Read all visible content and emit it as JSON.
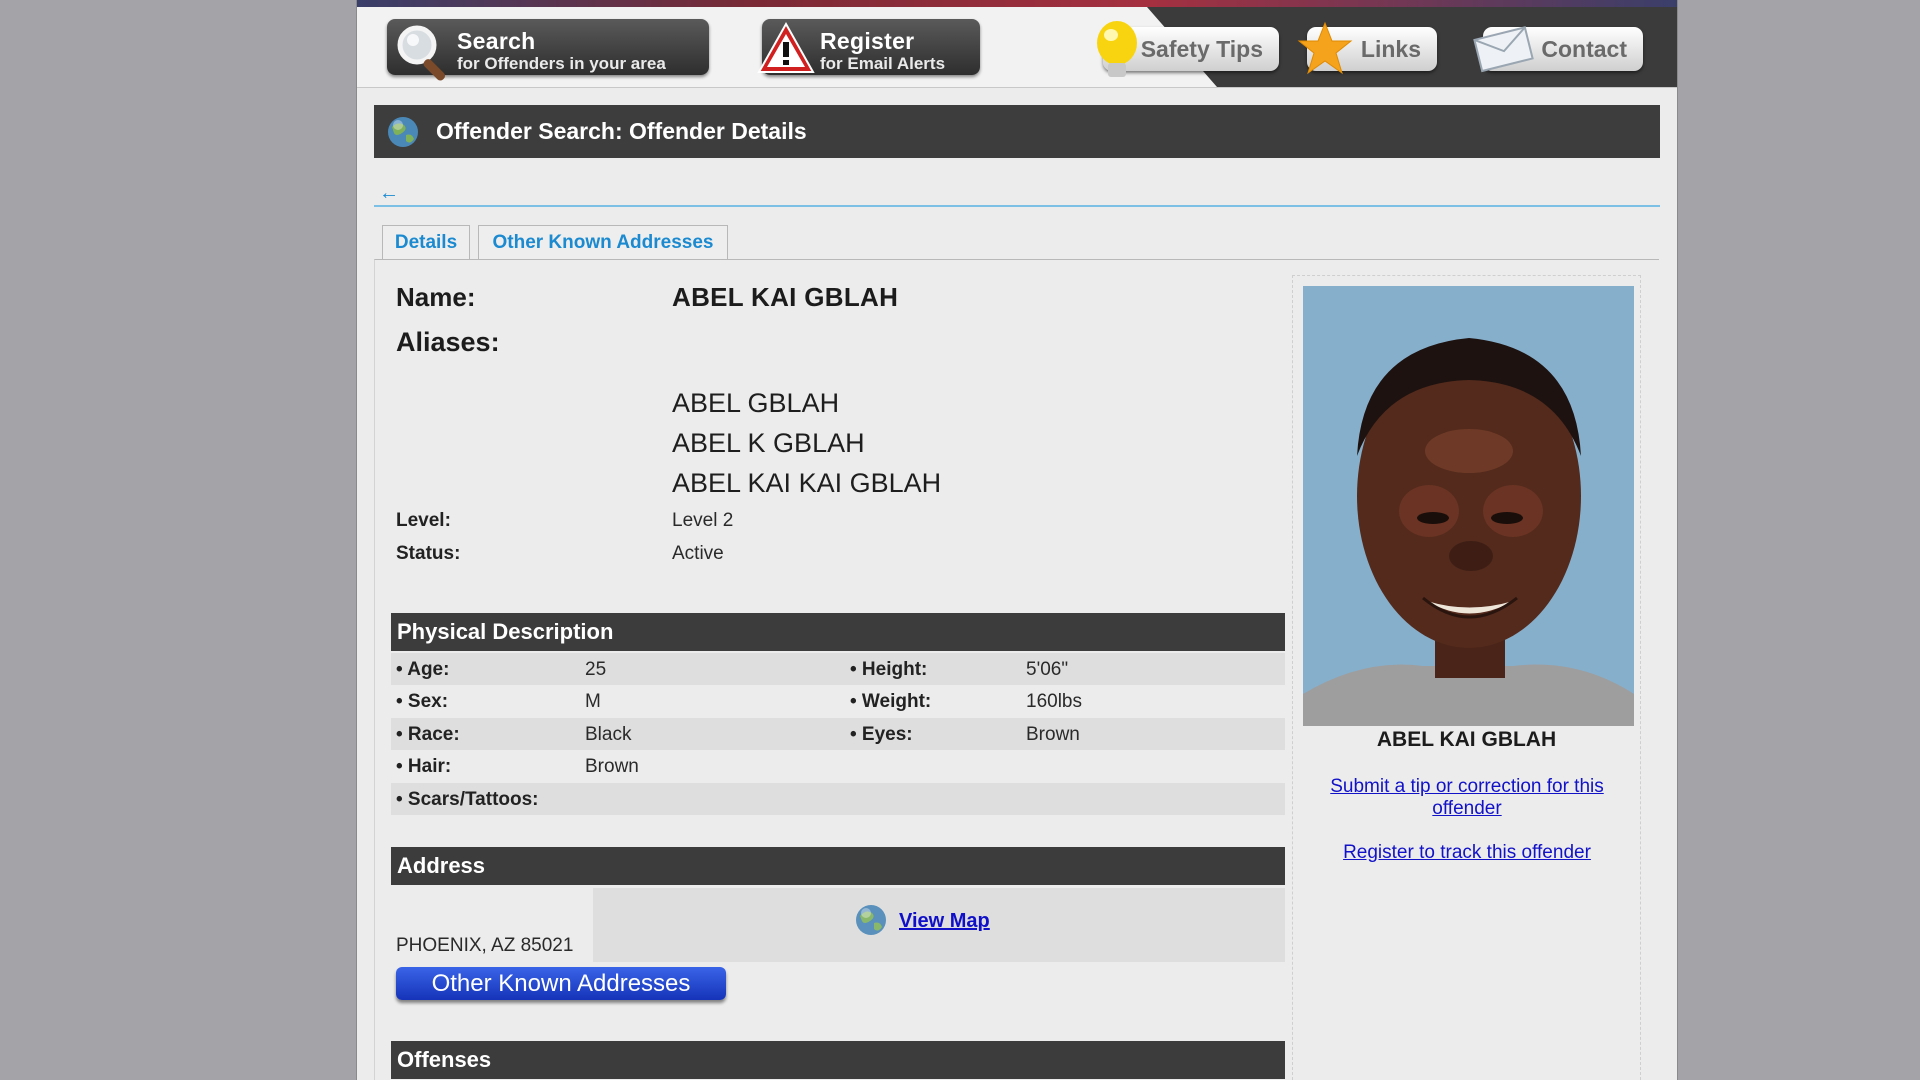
{
  "nav": {
    "search": {
      "title": "Search",
      "subtitle": "for Offenders in your area",
      "icon": "magnifier-icon"
    },
    "register": {
      "title": "Register",
      "subtitle": "for Email Alerts",
      "icon": "warning-icon"
    },
    "safety_tips": {
      "label": "Safety Tips",
      "icon": "lightbulb-icon"
    },
    "links": {
      "label": "Links",
      "icon": "star-icon"
    },
    "contact": {
      "label": "Contact",
      "icon": "envelope-icon"
    }
  },
  "page_title": "Offender Search: Offender Details",
  "back_arrow": "←",
  "tabs": [
    {
      "label": "Details",
      "active": true
    },
    {
      "label": "Other Known Addresses",
      "active": false
    }
  ],
  "details": {
    "name_label": "Name:",
    "name": "ABEL KAI GBLAH",
    "aliases_label": "Aliases:",
    "aliases": [
      "ABEL GBLAH",
      "ABEL K GBLAH",
      "ABEL KAI KAI GBLAH"
    ],
    "level_label": "Level:",
    "level": "Level 2",
    "status_label": "Status:",
    "status": "Active"
  },
  "physical": {
    "title": "Physical Description",
    "age_label": "• Age:",
    "age": "25",
    "height_label": "• Height:",
    "height": "5'06\"",
    "sex_label": "• Sex:",
    "sex": "M",
    "weight_label": "• Weight:",
    "weight": "160lbs",
    "race_label": "• Race:",
    "race": "Black",
    "eyes_label": "• Eyes:",
    "eyes": "Brown",
    "hair_label": "• Hair:",
    "hair": "Brown",
    "scars_label": "• Scars/Tattoos:",
    "scars": ""
  },
  "address": {
    "title": "Address",
    "text": "PHOENIX, AZ 85021",
    "view_map": "View Map",
    "other_button": "Other Known Addresses"
  },
  "offenses": {
    "title": "Offenses"
  },
  "sidebar": {
    "photo_name": "ABEL KAI GBLAH",
    "tip_link": "Submit a tip or correction for this offender",
    "track_link": "Register to track this offender"
  },
  "colors": {
    "accent_blue": "#1b8ad0",
    "link": "#1212c8",
    "bar": "#3c3c3c"
  }
}
